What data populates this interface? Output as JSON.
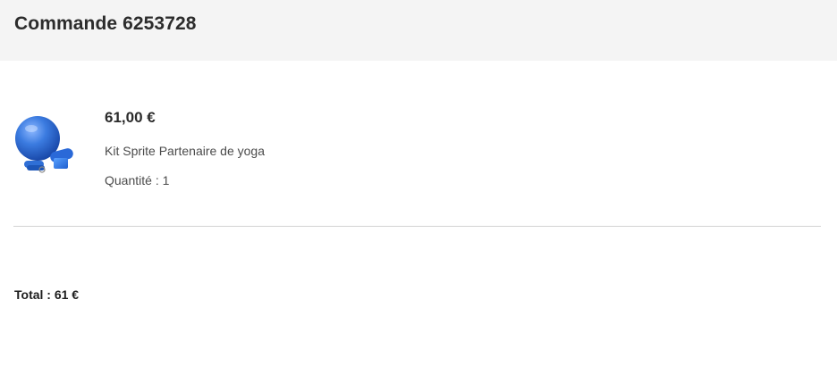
{
  "order": {
    "title": "Commande 6253728"
  },
  "item": {
    "image_icon": "yoga-kit-product-image",
    "price": "61,00 €",
    "name": "Kit Sprite Partenaire de yoga",
    "quantity_label": "Quantité : ",
    "quantity_value": "1"
  },
  "summary": {
    "total": "Total : 61 €"
  },
  "colors": {
    "header_bg": "#f4f4f4",
    "ball_blue": "#2f6fd6",
    "divider": "#d3d3d3"
  }
}
